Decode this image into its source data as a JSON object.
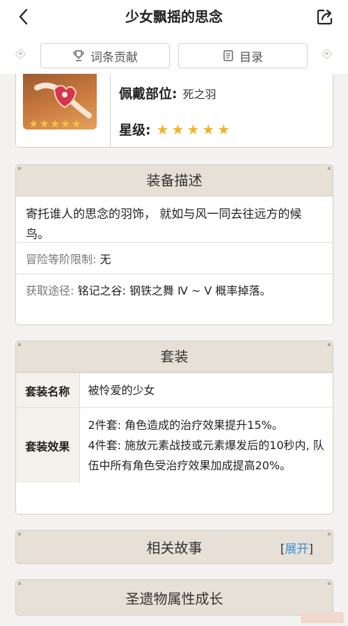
{
  "header": {
    "title": "少女飘摇的思念"
  },
  "nav": {
    "contribute": "词条贡献",
    "catalog": "目录"
  },
  "item": {
    "slot_label": "佩戴部位:",
    "slot_value": "死之羽",
    "rarity_label": "星级:",
    "rarity_stars": "★★★★★",
    "image_stars": "★★★★★"
  },
  "description": {
    "title": "装备描述",
    "text": "寄托谁人的思念的羽饰， 就如与风一同去往远方的候鸟。",
    "level_label": "冒险等阶限制:",
    "level_value": "无",
    "source_label": "获取途径:",
    "source_value": "铭记之谷: 钢铁之舞 Ⅳ ~ Ⅴ 概率掉落。"
  },
  "set": {
    "title": "套装",
    "name_label": "套装名称",
    "name_value": "被怜爱的少女",
    "effect_label": "套装效果",
    "effect_2": "2件套: 角色造成的治疗效果提升15%。",
    "effect_4": "4件套: 施放元素战技或元素爆发后的10秒内, 队伍中所有角色受治疗效果加成提高20%。"
  },
  "story": {
    "title": "相关故事",
    "expand_open": "[",
    "expand_label": "展开",
    "expand_close": "]"
  },
  "growth": {
    "title": "圣遗物属性成长"
  },
  "colors": {
    "accent_link": "#3a8fd6",
    "header_bg": "#e6e0d6",
    "star": "#f0b429"
  }
}
